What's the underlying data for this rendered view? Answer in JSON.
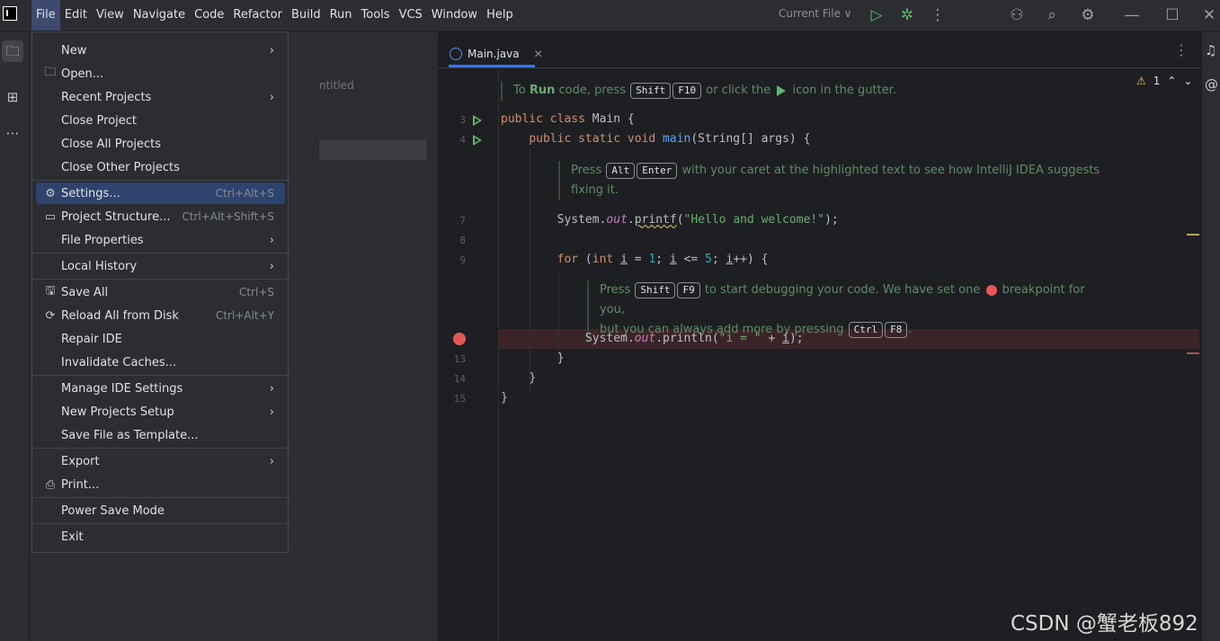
{
  "menubar": {
    "items": [
      "File",
      "Edit",
      "View",
      "Navigate",
      "Code",
      "Refactor",
      "Build",
      "Run",
      "Tools",
      "VCS",
      "Window",
      "Help"
    ],
    "active_index": 0
  },
  "toolbar": {
    "run_config": "Current File ∨"
  },
  "project_panel": {
    "partial_text": "ntitled"
  },
  "editor": {
    "tab_label": "Main.java",
    "inspection_count": "1",
    "line_numbers": [
      "3",
      "4",
      "7",
      "8",
      "9",
      "13",
      "14",
      "15"
    ],
    "hint1": {
      "prefix": "To ",
      "bold": "Run",
      "mid": " code, press ",
      "key1": "Shift",
      "key2": "F10",
      "mid2": " or click the ",
      "suffix": " icon in the gutter."
    },
    "hint2": {
      "prefix": "Press ",
      "key1": "Alt",
      "key2": "Enter",
      "line1_suffix": " with your caret at the highlighted text to see how IntelliJ IDEA suggests",
      "line2": "fixing it."
    },
    "hint3": {
      "prefix": "Press ",
      "key1": "Shift",
      "key2": "F9",
      "mid": " to start debugging your code. We have set one ",
      "suffix": " breakpoint for you,",
      "line2_prefix": "but you can always add more by pressing ",
      "key3": "Ctrl",
      "key4": "F8",
      "line2_suffix": "."
    },
    "code": {
      "l3_kw": "public class",
      "l3_rest": " Main {",
      "l4_kw": "public static void",
      "l4_fn": "main",
      "l4_rest": "(String[] args) {",
      "l7_a": "System.",
      "l7_fld": "out",
      "l7_b": ".",
      "l7_fn": "printf",
      "l7_c": "(",
      "l7_str": "\"Hello and welcome!\"",
      "l7_d": ");",
      "l9_kw": "for",
      "l9_a": " (",
      "l9_kw2": "int",
      "l9_b": " ",
      "l9_i": "i",
      "l9_c": " = ",
      "l9_n1": "1",
      "l9_d": "; ",
      "l9_i2": "i",
      "l9_e": " <= ",
      "l9_n2": "5",
      "l9_f": "; ",
      "l9_i3": "i",
      "l9_g": "++) {",
      "l12_a": "System.",
      "l12_fld": "out",
      "l12_b": ".println(",
      "l12_str": "\"i = \"",
      "l12_c": " + ",
      "l12_i": "i",
      "l12_d": ");",
      "l13": "}",
      "l14": "}",
      "l15": "}"
    }
  },
  "file_menu": [
    {
      "label": "New",
      "icon": "",
      "shortcut": "",
      "submenu": true
    },
    {
      "label": "Open...",
      "icon": "folder-icon",
      "shortcut": "",
      "submenu": false
    },
    {
      "label": "Recent Projects",
      "icon": "",
      "shortcut": "",
      "submenu": true
    },
    {
      "label": "Close Project",
      "icon": "",
      "shortcut": "",
      "submenu": false
    },
    {
      "label": "Close All Projects",
      "icon": "",
      "shortcut": "",
      "submenu": false
    },
    {
      "label": "Close Other Projects",
      "icon": "",
      "shortcut": "",
      "submenu": false
    },
    {
      "label": "Settings...",
      "icon": "gear-icon",
      "shortcut": "Ctrl+Alt+S",
      "submenu": false
    },
    {
      "label": "Project Structure...",
      "icon": "project-structure-icon",
      "shortcut": "Ctrl+Alt+Shift+S",
      "submenu": false
    },
    {
      "label": "File Properties",
      "icon": "",
      "shortcut": "",
      "submenu": true
    },
    {
      "label": "Local History",
      "icon": "",
      "shortcut": "",
      "submenu": true
    },
    {
      "label": "Save All",
      "icon": "save-icon",
      "shortcut": "Ctrl+S",
      "submenu": false
    },
    {
      "label": "Reload All from Disk",
      "icon": "reload-icon",
      "shortcut": "Ctrl+Alt+Y",
      "submenu": false
    },
    {
      "label": "Repair IDE",
      "icon": "",
      "shortcut": "",
      "submenu": false
    },
    {
      "label": "Invalidate Caches...",
      "icon": "",
      "shortcut": "",
      "submenu": false
    },
    {
      "label": "Manage IDE Settings",
      "icon": "",
      "shortcut": "",
      "submenu": true
    },
    {
      "label": "New Projects Setup",
      "icon": "",
      "shortcut": "",
      "submenu": true
    },
    {
      "label": "Save File as Template...",
      "icon": "",
      "shortcut": "",
      "submenu": false
    },
    {
      "label": "Export",
      "icon": "",
      "shortcut": "",
      "submenu": true
    },
    {
      "label": "Print...",
      "icon": "print-icon",
      "shortcut": "",
      "submenu": false
    },
    {
      "label": "Power Save Mode",
      "icon": "",
      "shortcut": "",
      "submenu": false
    },
    {
      "label": "Exit",
      "icon": "",
      "shortcut": "",
      "submenu": false
    }
  ],
  "watermark": "CSDN @蟹老板892"
}
